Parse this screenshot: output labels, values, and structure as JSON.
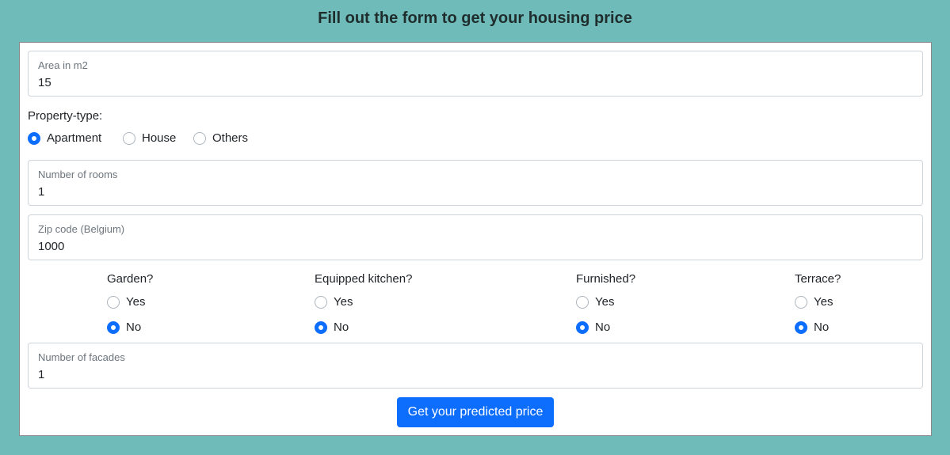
{
  "title": "Fill out the form to get your housing price",
  "area": {
    "label": "Area in m2",
    "value": "15"
  },
  "property_type": {
    "label": "Property-type:",
    "options": [
      "Apartment",
      "House",
      "Others"
    ],
    "selected": "Apartment"
  },
  "rooms": {
    "label": "Number of rooms",
    "value": "1"
  },
  "zip": {
    "label": "Zip code (Belgium)",
    "value": "1000"
  },
  "yes_no_groups": [
    {
      "label": "Garden?",
      "yes": "Yes",
      "no": "No",
      "selected": "No"
    },
    {
      "label": "Equipped kitchen?",
      "yes": "Yes",
      "no": "No",
      "selected": "No"
    },
    {
      "label": "Furnished?",
      "yes": "Yes",
      "no": "No",
      "selected": "No"
    },
    {
      "label": "Terrace?",
      "yes": "Yes",
      "no": "No",
      "selected": "No"
    }
  ],
  "facades": {
    "label": "Number of facades",
    "value": "1"
  },
  "submit_label": "Get your predicted price",
  "colors": {
    "background": "#6fbbb9",
    "accent": "#0d6efd"
  }
}
